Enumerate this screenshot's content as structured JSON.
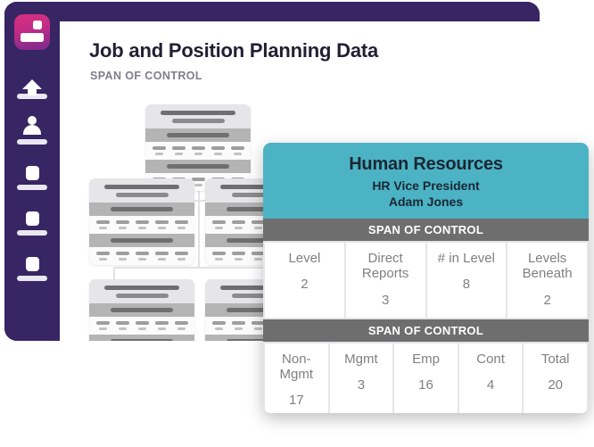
{
  "app": {
    "title": "Job and Position Planning Data",
    "section_label": "SPAN OF CONTROL",
    "colors": {
      "sidebar": "#382563",
      "logo_gradient_start": "#d6317f",
      "logo_gradient_end": "#7a2a8e",
      "card_header": "#4bb3c4",
      "band": "#6e6e6e"
    }
  },
  "sidebar": {
    "logo": "app-logo",
    "items": [
      {
        "icon": "upload-icon"
      },
      {
        "icon": "person-icon"
      },
      {
        "icon": "square-icon"
      },
      {
        "icon": "square-icon"
      },
      {
        "icon": "square-icon"
      }
    ]
  },
  "org_chart": {
    "nodes": [
      {
        "id": "node-root"
      },
      {
        "id": "node-left"
      },
      {
        "id": "node-right"
      },
      {
        "id": "node-bottom-left"
      },
      {
        "id": "node-bottom-right"
      }
    ]
  },
  "detail_card": {
    "org": "Human Resources",
    "role": "HR Vice President",
    "person": "Adam Jones",
    "span_label_1": "SPAN OF CONTROL",
    "span_label_2": "SPAN OF CONTROL",
    "table_1": {
      "headers": [
        "Level",
        "Direct Reports",
        "# in Level",
        "Levels Beneath"
      ],
      "values": [
        "2",
        "3",
        "8",
        "2"
      ]
    },
    "table_2": {
      "headers": [
        "Non-Mgmt",
        "Mgmt",
        "Emp",
        "Cont",
        "Total"
      ],
      "values": [
        "17",
        "3",
        "16",
        "4",
        "20"
      ]
    }
  }
}
